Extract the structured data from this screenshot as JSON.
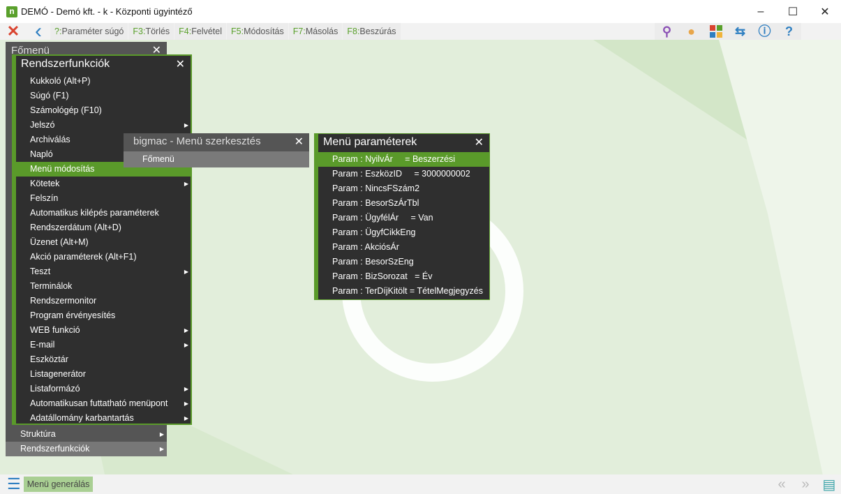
{
  "window": {
    "title": "DEMÓ - Demó kft. - k - Központi ügyintéző",
    "minimize": "–",
    "maximize": "☐",
    "close": "✕"
  },
  "toolbar": {
    "close_icon": "✕",
    "back_icon": "‹",
    "buttons": [
      {
        "key": "?:",
        "label": "Paraméter súgó"
      },
      {
        "key": "F3:",
        "label": "Törlés"
      },
      {
        "key": "F4:",
        "label": "Felvétel"
      },
      {
        "key": "F5:",
        "label": "Módosítás"
      },
      {
        "key": "F7:",
        "label": "Másolás"
      },
      {
        "key": "F8:",
        "label": "Beszúrás"
      }
    ],
    "icons": [
      "search-icon",
      "user-icon",
      "apps-icon",
      "swap-icon",
      "info-icon",
      "help-icon"
    ]
  },
  "fomenu": {
    "title": "Főmenü",
    "items": [
      {
        "label": "Struktúra"
      },
      {
        "label": "Rendszerfunkciók"
      }
    ]
  },
  "rendszer": {
    "title": "Rendszerfunkciók",
    "items": [
      {
        "label": "Kukkoló (Alt+P)",
        "sub": false
      },
      {
        "label": "Súgó (F1)",
        "sub": false
      },
      {
        "label": "Számológép (F10)",
        "sub": false
      },
      {
        "label": "Jelszó",
        "sub": true
      },
      {
        "label": "Archiválás",
        "sub": false
      },
      {
        "label": "Napló",
        "sub": false
      },
      {
        "label": "Menü módosítás",
        "sub": false,
        "selected": true
      },
      {
        "label": "Kötetek",
        "sub": true
      },
      {
        "label": "Felszín",
        "sub": false
      },
      {
        "label": "Automatikus kilépés paraméterek",
        "sub": false
      },
      {
        "label": "Rendszerdátum (Alt+D)",
        "sub": false
      },
      {
        "label": "Üzenet (Alt+M)",
        "sub": false
      },
      {
        "label": "Akció paraméterek (Alt+F1)",
        "sub": false
      },
      {
        "label": "Teszt",
        "sub": true
      },
      {
        "label": "Terminálok",
        "sub": false
      },
      {
        "label": "Rendszermonitor",
        "sub": false
      },
      {
        "label": "Program érvényesítés",
        "sub": false
      },
      {
        "label": "WEB funkció",
        "sub": true
      },
      {
        "label": "E-mail",
        "sub": true
      },
      {
        "label": "Eszköztár",
        "sub": false
      },
      {
        "label": "Listagenerátor",
        "sub": false
      },
      {
        "label": "Listaformázó",
        "sub": true
      },
      {
        "label": "Automatikusan futtatható menüpont",
        "sub": true
      },
      {
        "label": "Adatállomány karbantartás",
        "sub": true
      }
    ]
  },
  "bigmac": {
    "title": "bigmac - Menü szerkesztés",
    "item": "Főmenü"
  },
  "params": {
    "title": "Menü paraméterek",
    "items": [
      "Param : NyilvÁr     = Beszerzési",
      "Param : EszközID     = 3000000002",
      "Param : NincsFSzám2",
      "Param : BesorSzÁrTbl",
      "Param : ÜgyfélÁr     = Van",
      "Param : ÜgyfCikkEng",
      "Param : AkciósÁr",
      "Param : BesorSzEng",
      "Param : BizSorozat   = Év",
      "Param : TerDíjKitölt = TételMegjegyzés"
    ]
  },
  "bottom": {
    "generate": "Menü generálás"
  },
  "colors": {
    "accent": "#5a9a2a",
    "background": "#e2eedb"
  }
}
